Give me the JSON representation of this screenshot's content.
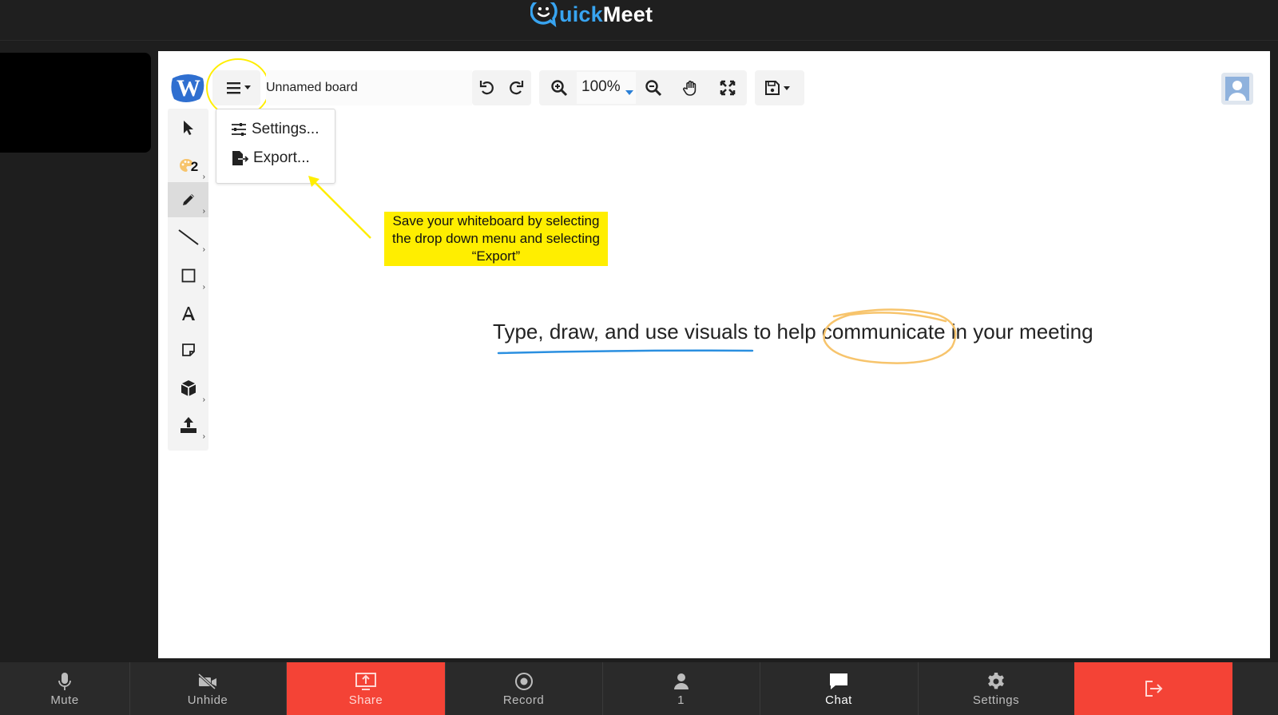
{
  "header": {
    "logo_text_quick": "uick",
    "logo_text_meet": "Meet"
  },
  "toolbar": {
    "board_name": "Unnamed board",
    "zoom": "100%"
  },
  "menu": {
    "items": [
      {
        "label": "Settings..."
      },
      {
        "label": "Export..."
      }
    ]
  },
  "left_toolbar": {
    "color_count": "2"
  },
  "annotation": {
    "callout_text": "Save your whiteboard by selecting the drop down menu and selecting “Export”"
  },
  "canvas": {
    "text_before": "Type, draw, and use visuals to help ",
    "text_circled": "communicate",
    "text_after": " in your meeting"
  },
  "bottom_bar": {
    "mute": "Mute",
    "unhide": "Unhide",
    "share": "Share",
    "record": "Record",
    "participants": "1",
    "chat": "Chat",
    "settings": "Settings"
  },
  "colors": {
    "accent_blue": "#38a4f0",
    "danger_red": "#f44336",
    "highlight_yellow": "#ffee00",
    "underline_blue": "#2a8fe0",
    "circle_orange": "#f7c46c"
  }
}
